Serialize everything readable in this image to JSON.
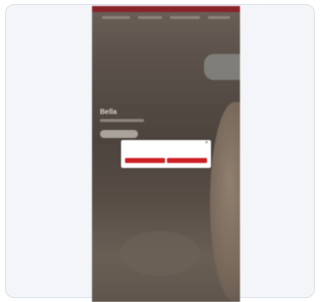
{
  "hero": {
    "title": "Bella"
  },
  "dialog": {
    "title": "",
    "body": "",
    "close_icon": "close-icon",
    "primary_label": "",
    "secondary_label": ""
  },
  "colors": {
    "accent": "#cc1e24",
    "top_bar": "#8a2328",
    "overlay": "#4d443e"
  }
}
